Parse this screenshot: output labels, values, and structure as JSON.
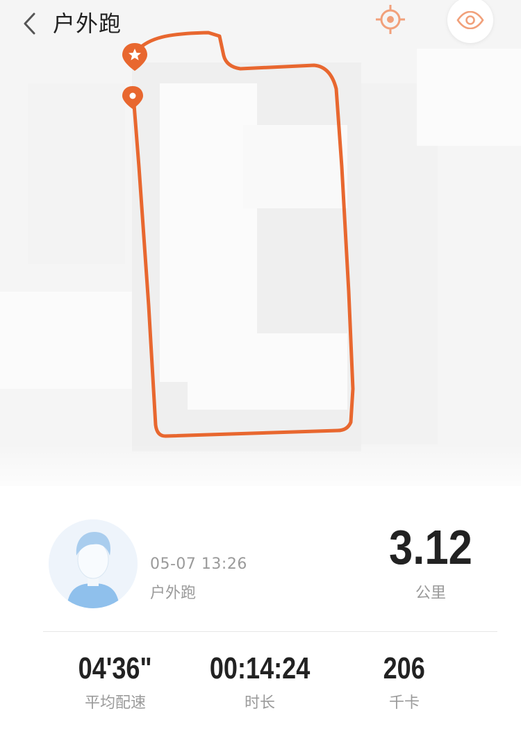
{
  "header": {
    "title": "户外跑",
    "back_icon": "chevron-left-icon",
    "locate_icon": "crosshair-icon",
    "eye_icon": "eye-icon"
  },
  "map": {
    "route_color": "#e8672f",
    "marker_start_icon": "star-pin-icon",
    "marker_end_icon": "location-pin-icon"
  },
  "summary": {
    "date": "05-07 13:26",
    "type": "户外跑",
    "distance": "3.12",
    "distance_unit": "公里",
    "avatar_icon": "user-avatar-icon"
  },
  "stats": [
    {
      "value": "04'36\"",
      "label": "平均配速"
    },
    {
      "value": "00:14:24",
      "label": "时长"
    },
    {
      "value": "206",
      "label": "千卡"
    }
  ]
}
